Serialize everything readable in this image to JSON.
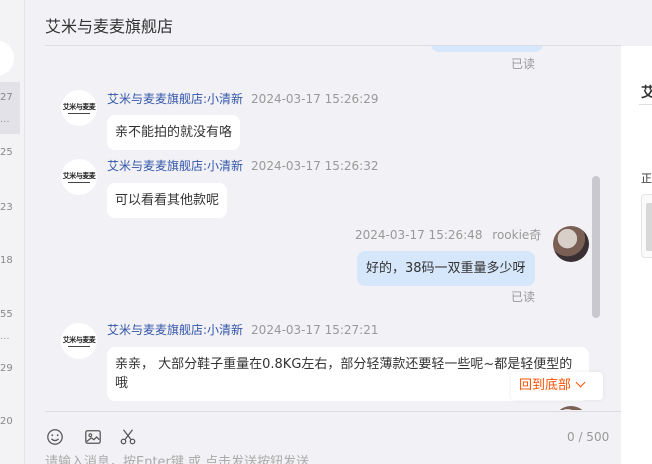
{
  "left_list": {
    "times": [
      "27",
      "25",
      "23",
      "18",
      "55",
      "29",
      "20"
    ],
    "ellipsis": "..."
  },
  "chat": {
    "title": "艾米与麦麦旗舰店",
    "read_label": "已读",
    "avatar_shop_text": "艾米与麦麦",
    "messages": [
      {
        "from": "shop",
        "sender": "艾米与麦麦旗舰店:小清新",
        "time": "2024-03-17 15:26:29",
        "text": "亲不能拍的就没有咯"
      },
      {
        "from": "shop",
        "sender": "艾米与麦麦旗舰店:小清新",
        "time": "2024-03-17 15:26:32",
        "text": "可以看看其他款呢"
      },
      {
        "from": "me",
        "sender": "rookie奇",
        "time": "2024-03-17 15:26:48",
        "text": "好的，38码一双重量多少呀",
        "status": "已读"
      },
      {
        "from": "shop",
        "sender": "艾米与麦麦旗舰店:小清新",
        "time": "2024-03-17 15:27:21",
        "text": "亲亲， 大部分鞋子重量在0.8KG左右，部分轻薄款还要轻一些呢~都是轻便型的哦"
      }
    ],
    "back_to_bottom": "回到底部",
    "counter": "0 / 500",
    "input_placeholder": "请输入消息，按Enter键 或 点击发送按钮发送",
    "toolbar_icons": [
      "emoji-icon",
      "image-icon",
      "scissors-icon"
    ]
  },
  "right_panel": {
    "title": "艾",
    "label": "正"
  },
  "colors": {
    "sender": "#3355a8",
    "my_bubble": "#d6e6fb",
    "accent": "#ff5000"
  }
}
